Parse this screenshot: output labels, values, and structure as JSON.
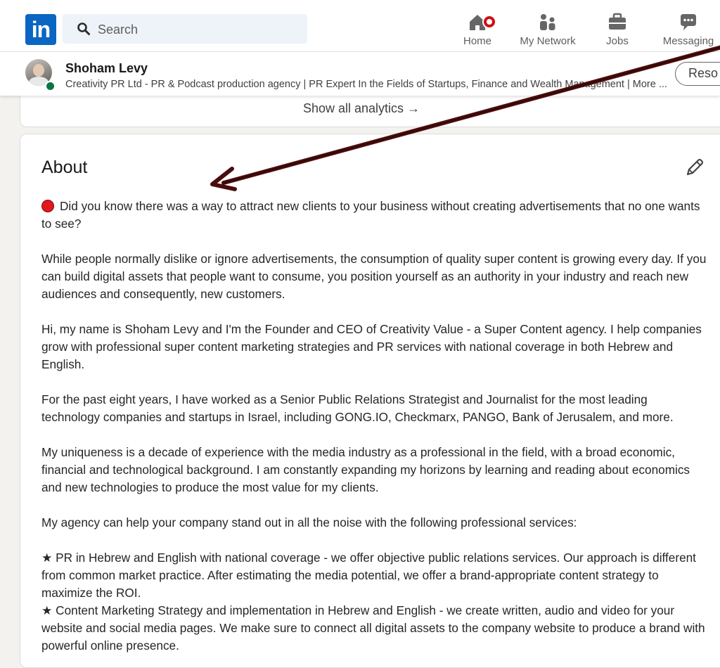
{
  "nav": {
    "logo": "in",
    "search_placeholder": "Search",
    "items": [
      {
        "label": "Home",
        "icon": "home-icon"
      },
      {
        "label": "My Network",
        "icon": "network-icon"
      },
      {
        "label": "Jobs",
        "icon": "briefcase-icon"
      },
      {
        "label": "Messaging",
        "icon": "message-icon"
      }
    ]
  },
  "profile": {
    "name": "Shoham Levy",
    "headline": "Creativity PR Ltd - PR & Podcast production agency | PR Expert In the Fields of Startups, Finance and Wealth Management | More ...",
    "resources_button": "Reso"
  },
  "analytics": {
    "show_all": "Show all analytics →"
  },
  "about": {
    "title": "About",
    "paragraphs": [
      "Did you know there was a way to attract new clients to your business without creating advertisements that no one wants to see?",
      "While people normally dislike or ignore advertisements, the consumption of quality super content is growing every day. If you can build digital assets that people want to consume, you position yourself as an authority in your industry and reach new audiences and consequently, new customers.",
      "Hi, my name is Shoham Levy and I'm the Founder and CEO of Creativity Value - a Super Content agency. I help companies grow with professional super content marketing strategies and PR services with national coverage in both Hebrew and English.",
      "For the past eight years, I have worked as a Senior Public Relations Strategist and Journalist for the most leading technology companies and startups in Israel, including GONG.IO, Checkmarx, PANGO, Bank of Jerusalem, and more.",
      "My uniqueness is a decade of experience with the media industry as a professional in the field, with a broad economic, financial and technological background. I am constantly expanding my horizons by learning and reading about economics and new technologies to produce the most value for my clients.",
      "My agency can help your company stand out in all the noise with the following professional services:",
      "★ PR in Hebrew and English with national coverage - we offer objective public relations services. Our approach is different from common market practice. After estimating the media potential, we offer a brand-appropriate content strategy to maximize the ROI.",
      "★ Content Marketing Strategy and implementation in Hebrew and English - we create written, audio and video for your website and social media pages. We make sure to connect all digital assets to the company website to produce a brand with powerful online presence."
    ]
  },
  "colors": {
    "brand": "#0a66c2",
    "annotation_arrow": "#4a0d0d",
    "bullet_dot": "#e2171f"
  }
}
